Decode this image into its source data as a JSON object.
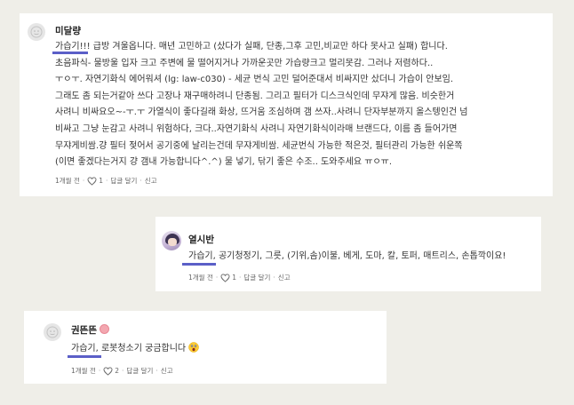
{
  "comments": [
    {
      "username": "미달량",
      "lines": [
        "가습기!!! 급방 겨울옵니다. 매년 고민하고 (샀다가 실패, 단종,그후 고민,비교만 하다 못사고 실패) 합니다.",
        "초음파식- 물방울 입자 크고 주변에 물 떨어지거나 가까운곳만 가습량크고 멀리못감. 그러나 저렴하다..",
        "ㅜㅇㅜ. 자연기화식 에어워셔 (lg: law-c030) - 세균 번식 고민 덜어준대서 비싸지만 샀더니 가습이 안보임.",
        "그래도 좀 되는거같아 쓰다 고장나 재구매하려니 단종됨. 그리고 필터가 디스크식인데 무쟈게 많음. 비슷한거",
        "사려니 비싸요오~-ㅜ.ㅜ 가열식이 좋다길래 화상, 뜨거움 조심하며 갬 쓰자..사려니 단자부분까지 올스텡인건 넘",
        "비싸고 그냥 눈감고 사려니 위험하다, 크다..자연기화식 사려니 자연기화식이라매 브랜드다, 이름 좀 들어가면",
        "무쟈게비쌈.걍 필터 젖어서 공기중에 날리는건데 무쟈게비쌈. 세균번식 가능한 적은것, 필터관리 가능한 쉬운쪽",
        "(이면 좋겠다는거지 걍 갬내 가능합니다^.^) 물 넣기, 닦기 좋은 수조.. 도와주세요 ㅠㅇㅠ."
      ],
      "time": "1개월 전",
      "likes": "1",
      "reply_label": "답글 달기",
      "report_label": "신고"
    },
    {
      "username": "열시반",
      "lines": [
        "가습기, 공기청정기, 그릇, (기위,솜)이불, 베게, 도마, 칼, 토퍼, 매트리스, 손톱깍이요!"
      ],
      "time": "1개월 전",
      "likes": "1",
      "reply_label": "답글 달기",
      "report_label": "신고"
    },
    {
      "username": "권뜬뜬",
      "lines": [
        "가습기, 로봇청소기 궁금합니다"
      ],
      "emoji": "shocked-face",
      "time": "1개월 전",
      "likes": "2",
      "reply_label": "답글 달기",
      "report_label": "신고"
    }
  ],
  "highlight_color": "#5b5fc7"
}
